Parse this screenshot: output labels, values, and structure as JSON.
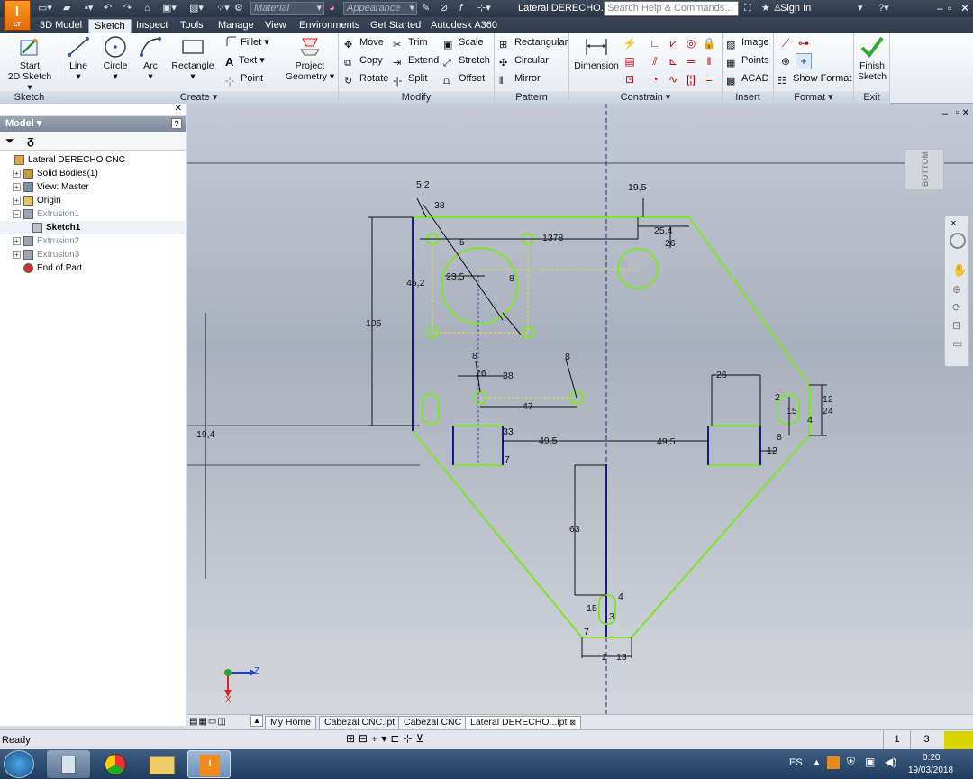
{
  "app": {
    "doc_title": "Lateral DERECHO...",
    "material_placeholder": "Material",
    "appearance_placeholder": "Appearance",
    "search_placeholder": "Search Help & Commands...",
    "signin": "Sign In",
    "logo": "I",
    "logo_sub": "LT"
  },
  "tabs": [
    "3D Model",
    "Sketch",
    "Inspect",
    "Tools",
    "Manage",
    "View",
    "Environments",
    "Get Started",
    "Autodesk A360"
  ],
  "active_tab": "Sketch",
  "ribbon": {
    "sketch": {
      "title": "Sketch",
      "start": "Start",
      "start2": "2D Sketch"
    },
    "create": {
      "title": "Create",
      "line": "Line",
      "circle": "Circle",
      "arc": "Arc",
      "rectangle": "Rectangle",
      "fillet": "Fillet",
      "text": "Text",
      "point": "Point",
      "project": "Project",
      "project2": "Geometry"
    },
    "modify": {
      "title": "Modify",
      "move": "Move",
      "trim": "Trim",
      "scale": "Scale",
      "copy": "Copy",
      "extend": "Extend",
      "stretch": "Stretch",
      "rotate": "Rotate",
      "split": "Split",
      "offset": "Offset"
    },
    "pattern": {
      "title": "Pattern",
      "rectangular": "Rectangular",
      "circular": "Circular",
      "mirror": "Mirror"
    },
    "constrain": {
      "title": "Constrain",
      "dimension": "Dimension"
    },
    "insert": {
      "title": "Insert",
      "image": "Image",
      "points": "Points",
      "acad": "ACAD"
    },
    "format": {
      "title": "Format",
      "show_format": "Show Format"
    },
    "exit": {
      "title": "Exit",
      "finish": "Finish",
      "finish2": "Sketch"
    }
  },
  "browser": {
    "title": "Model",
    "tree": [
      {
        "label": "Lateral DERECHO CNC",
        "level": 0,
        "icon": "part",
        "style": ""
      },
      {
        "label": "Solid Bodies(1)",
        "level": 1,
        "icon": "solid",
        "style": ""
      },
      {
        "label": "View: Master",
        "level": 1,
        "icon": "view",
        "style": ""
      },
      {
        "label": "Origin",
        "level": 1,
        "icon": "folder",
        "style": ""
      },
      {
        "label": "Extrusion1",
        "level": 1,
        "icon": "extrude",
        "style": "dim"
      },
      {
        "label": "Sketch1",
        "level": 2,
        "icon": "sketch",
        "style": "bold"
      },
      {
        "label": "Extrusion2",
        "level": 1,
        "icon": "extrude",
        "style": "dim"
      },
      {
        "label": "Extrusion3",
        "level": 1,
        "icon": "extrude",
        "style": "dim"
      },
      {
        "label": "End of Part",
        "level": 1,
        "icon": "end",
        "style": ""
      }
    ]
  },
  "viewcube": "BOTTOM",
  "dims": {
    "d52": "5,2",
    "d38": "38",
    "d195": "19,5",
    "d5": "5",
    "d1378": "1378",
    "d254": "25,4",
    "d26a": "26",
    "d235": "23,5",
    "d8a": "8",
    "d452": "45,2",
    "d105": "105",
    "d8b": "8",
    "d26b": "26",
    "d38b": "38",
    "d8c": "8",
    "d47": "47",
    "d26c": "26",
    "d2": "2",
    "d15a": "15",
    "d12a": "12",
    "d24": "24",
    "d4a": "4",
    "d8d": "8",
    "d12b": "12",
    "d194": "19,4",
    "d33": "33",
    "d495a": "49,5",
    "d495b": "49,5",
    "d7": "7",
    "d63": "63",
    "d4b": "4",
    "d15b": "15",
    "d3": "3",
    "d7b": "7",
    "d2b": "2",
    "d13": "13"
  },
  "axes": {
    "z": "Z",
    "x": "X"
  },
  "doctabs": [
    "My Home",
    "Cabezal CNC.ipt",
    "Cabezal CNC",
    "Lateral DERECHO...ipt"
  ],
  "status": {
    "text": "Ready",
    "count1": "1",
    "count2": "3"
  },
  "taskbar": {
    "lang": "ES",
    "time": "0:20",
    "date": "19/03/2018"
  },
  "colors": {
    "sketch_green": "#7fe52a",
    "constrained_blue": "#1a1a8c",
    "dim_black": "#111111"
  }
}
